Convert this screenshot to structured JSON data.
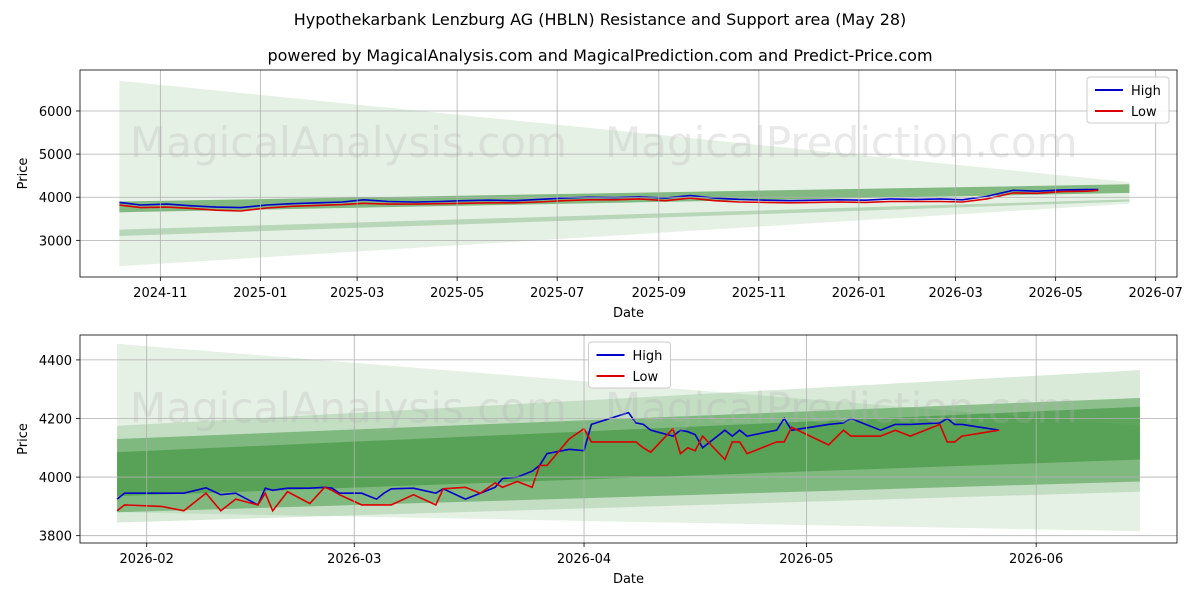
{
  "title": "Hypothekarbank Lenzburg AG (HBLN) Resistance and Support area (May 28)",
  "subtitle": "powered by MagicalAnalysis.com and MagicalPrediction.com and Predict-Price.com",
  "watermarks": [
    "MagicalAnalysis.com",
    "MagicalPrediction.com"
  ],
  "colors": {
    "high": "#0000cc",
    "low": "#dd0000",
    "band": "#2e8b2e",
    "grid": "#b0b0b0"
  },
  "chart_data": [
    {
      "type": "line",
      "xlabel": "Date",
      "ylabel": "Price",
      "x_ticks": [
        "2024-11",
        "2025-01",
        "2025-03",
        "2025-05",
        "2025-07",
        "2025-09",
        "2025-11",
        "2026-01",
        "2026-03",
        "2026-05",
        "2026-07"
      ],
      "y_ticks": [
        3000,
        4000,
        5000,
        6000
      ],
      "xlim": [
        "2024-09-13",
        "2026-07-14"
      ],
      "ylim": [
        2150,
        6950
      ],
      "grid": true,
      "legend_position": "top-right",
      "series": [
        {
          "name": "High",
          "x": [
            "2024-10-07",
            "2024-10-20",
            "2024-11-05",
            "2024-11-20",
            "2024-12-05",
            "2024-12-20",
            "2025-01-05",
            "2025-01-20",
            "2025-02-05",
            "2025-02-20",
            "2025-03-05",
            "2025-03-20",
            "2025-04-05",
            "2025-04-20",
            "2025-05-05",
            "2025-05-20",
            "2025-06-05",
            "2025-06-20",
            "2025-07-05",
            "2025-07-20",
            "2025-08-05",
            "2025-08-20",
            "2025-09-05",
            "2025-09-20",
            "2025-10-05",
            "2025-10-20",
            "2025-11-05",
            "2025-11-20",
            "2025-12-05",
            "2025-12-20",
            "2026-01-05",
            "2026-01-20",
            "2026-02-05",
            "2026-02-20",
            "2026-03-05",
            "2026-03-20",
            "2026-04-05",
            "2026-04-20",
            "2026-05-05",
            "2026-05-20",
            "2026-05-27"
          ],
          "values": [
            3880,
            3820,
            3840,
            3800,
            3770,
            3760,
            3820,
            3850,
            3870,
            3890,
            3940,
            3900,
            3890,
            3900,
            3920,
            3930,
            3920,
            3950,
            3980,
            4000,
            3990,
            4010,
            3980,
            4040,
            3980,
            3950,
            3930,
            3920,
            3930,
            3940,
            3930,
            3960,
            3950,
            3960,
            3940,
            4020,
            4160,
            4140,
            4170,
            4180,
            4180
          ]
        },
        {
          "name": "Low",
          "x": [
            "2024-10-07",
            "2024-10-20",
            "2024-11-05",
            "2024-11-20",
            "2024-12-05",
            "2024-12-20",
            "2025-01-05",
            "2025-01-20",
            "2025-02-05",
            "2025-02-20",
            "2025-03-05",
            "2025-03-20",
            "2025-04-05",
            "2025-04-20",
            "2025-05-05",
            "2025-05-20",
            "2025-06-05",
            "2025-06-20",
            "2025-07-05",
            "2025-07-20",
            "2025-08-05",
            "2025-08-20",
            "2025-09-05",
            "2025-09-20",
            "2025-10-05",
            "2025-10-20",
            "2025-11-05",
            "2025-11-20",
            "2025-12-05",
            "2025-12-20",
            "2026-01-05",
            "2026-01-20",
            "2026-02-05",
            "2026-02-20",
            "2026-03-05",
            "2026-03-20",
            "2026-04-05",
            "2026-04-20",
            "2026-05-05",
            "2026-05-20",
            "2026-05-27"
          ],
          "values": [
            3820,
            3760,
            3770,
            3740,
            3700,
            3680,
            3750,
            3790,
            3810,
            3830,
            3860,
            3840,
            3840,
            3850,
            3860,
            3870,
            3870,
            3890,
            3920,
            3940,
            3940,
            3960,
            3920,
            3980,
            3920,
            3890,
            3880,
            3870,
            3880,
            3890,
            3880,
            3900,
            3900,
            3900,
            3890,
            3960,
            4100,
            4090,
            4130,
            4140,
            4160
          ]
        }
      ],
      "bands": [
        {
          "start": "2024-10-07",
          "end": "2026-06-15",
          "upper": [
            6700,
            4350
          ],
          "lower": [
            2400,
            3850
          ],
          "opacity": 0.12
        },
        {
          "start": "2024-10-07",
          "end": "2026-06-15",
          "upper": [
            3900,
            4300
          ],
          "lower": [
            3650,
            4100
          ],
          "opacity": 0.55
        },
        {
          "start": "2024-10-07",
          "end": "2026-06-15",
          "upper": [
            3250,
            3950
          ],
          "lower": [
            3100,
            3900
          ],
          "opacity": 0.25
        }
      ]
    },
    {
      "type": "line",
      "xlabel": "Date",
      "ylabel": "Price",
      "x_ticks": [
        "2026-02",
        "2026-03",
        "2026-04",
        "2026-05",
        "2026-06"
      ],
      "y_ticks": [
        3800,
        4000,
        4200,
        4400
      ],
      "xlim": [
        "2026-01-23",
        "2026-06-20"
      ],
      "ylim": [
        3775,
        4485
      ],
      "grid": true,
      "legend_position": "top-center",
      "series": [
        {
          "name": "High",
          "x": [
            "2026-01-28",
            "2026-01-29",
            "2026-02-03",
            "2026-02-06",
            "2026-02-09",
            "2026-02-11",
            "2026-02-13",
            "2026-02-16",
            "2026-02-17",
            "2026-02-18",
            "2026-02-20",
            "2026-02-23",
            "2026-02-25",
            "2026-02-26",
            "2026-02-27",
            "2026-03-02",
            "2026-03-04",
            "2026-03-05",
            "2026-03-06",
            "2026-03-09",
            "2026-03-12",
            "2026-03-13",
            "2026-03-16",
            "2026-03-18",
            "2026-03-20",
            "2026-03-21",
            "2026-03-23",
            "2026-03-25",
            "2026-03-26",
            "2026-03-27",
            "2026-03-30",
            "2026-04-01",
            "2026-04-02",
            "2026-04-07",
            "2026-04-08",
            "2026-04-09",
            "2026-04-10",
            "2026-04-13",
            "2026-04-14",
            "2026-04-15",
            "2026-04-16",
            "2026-04-17",
            "2026-04-20",
            "2026-04-21",
            "2026-04-22",
            "2026-04-23",
            "2026-04-24",
            "2026-04-27",
            "2026-04-28",
            "2026-04-29",
            "2026-05-04",
            "2026-05-06",
            "2026-05-07",
            "2026-05-11",
            "2026-05-13",
            "2026-05-15",
            "2026-05-19",
            "2026-05-20",
            "2026-05-21",
            "2026-05-22",
            "2026-05-27"
          ],
          "values": [
            3925,
            3945,
            3945,
            3945,
            3963,
            3940,
            3945,
            3905,
            3962,
            3955,
            3962,
            3962,
            3965,
            3962,
            3945,
            3945,
            3925,
            3945,
            3960,
            3962,
            3945,
            3960,
            3925,
            3945,
            3965,
            3995,
            4000,
            4020,
            4040,
            4080,
            4095,
            4090,
            4180,
            4220,
            4185,
            4180,
            4160,
            4140,
            4160,
            4155,
            4145,
            4100,
            4160,
            4140,
            4160,
            4140,
            4145,
            4160,
            4200,
            4160,
            4180,
            4185,
            4200,
            4160,
            4180,
            4180,
            4185,
            4200,
            4180,
            4180,
            4160
          ]
        },
        {
          "name": "Low",
          "x": [
            "2026-01-28",
            "2026-01-29",
            "2026-02-03",
            "2026-02-06",
            "2026-02-09",
            "2026-02-11",
            "2026-02-13",
            "2026-02-16",
            "2026-02-17",
            "2026-02-18",
            "2026-02-20",
            "2026-02-23",
            "2026-02-25",
            "2026-02-26",
            "2026-02-27",
            "2026-03-02",
            "2026-03-04",
            "2026-03-05",
            "2026-03-06",
            "2026-03-09",
            "2026-03-12",
            "2026-03-13",
            "2026-03-16",
            "2026-03-18",
            "2026-03-20",
            "2026-03-21",
            "2026-03-23",
            "2026-03-25",
            "2026-03-26",
            "2026-03-27",
            "2026-03-30",
            "2026-04-01",
            "2026-04-02",
            "2026-04-07",
            "2026-04-08",
            "2026-04-09",
            "2026-04-10",
            "2026-04-13",
            "2026-04-14",
            "2026-04-15",
            "2026-04-16",
            "2026-04-17",
            "2026-04-20",
            "2026-04-21",
            "2026-04-22",
            "2026-04-23",
            "2026-04-24",
            "2026-04-27",
            "2026-04-28",
            "2026-04-29",
            "2026-05-04",
            "2026-05-06",
            "2026-05-07",
            "2026-05-11",
            "2026-05-13",
            "2026-05-15",
            "2026-05-19",
            "2026-05-20",
            "2026-05-21",
            "2026-05-22",
            "2026-05-27"
          ],
          "values": [
            3885,
            3905,
            3900,
            3885,
            3945,
            3885,
            3925,
            3905,
            3945,
            3885,
            3950,
            3910,
            3965,
            3955,
            3940,
            3905,
            3905,
            3905,
            3905,
            3940,
            3905,
            3960,
            3965,
            3945,
            3980,
            3965,
            3985,
            3965,
            4040,
            4040,
            4130,
            4165,
            4120,
            4120,
            4120,
            4100,
            4085,
            4165,
            4080,
            4100,
            4090,
            4140,
            4060,
            4120,
            4120,
            4080,
            4090,
            4120,
            4120,
            4170,
            4110,
            4160,
            4140,
            4140,
            4160,
            4140,
            4180,
            4120,
            4120,
            4140,
            4160
          ]
        }
      ],
      "bands": [
        {
          "start": "2026-01-28",
          "end": "2026-06-15",
          "upper": [
            4455,
            4175
          ],
          "lower": [
            3880,
            3815
          ],
          "opacity": 0.12
        },
        {
          "start": "2026-01-28",
          "end": "2026-06-15",
          "upper": [
            4175,
            4365
          ],
          "lower": [
            3845,
            3950
          ],
          "opacity": 0.18
        },
        {
          "start": "2026-01-28",
          "end": "2026-06-15",
          "upper": [
            4130,
            4270
          ],
          "lower": [
            3880,
            3985
          ],
          "opacity": 0.45
        },
        {
          "start": "2026-01-28",
          "end": "2026-06-15",
          "upper": [
            4085,
            4240
          ],
          "lower": [
            3935,
            4060
          ],
          "opacity": 0.5
        }
      ]
    }
  ]
}
